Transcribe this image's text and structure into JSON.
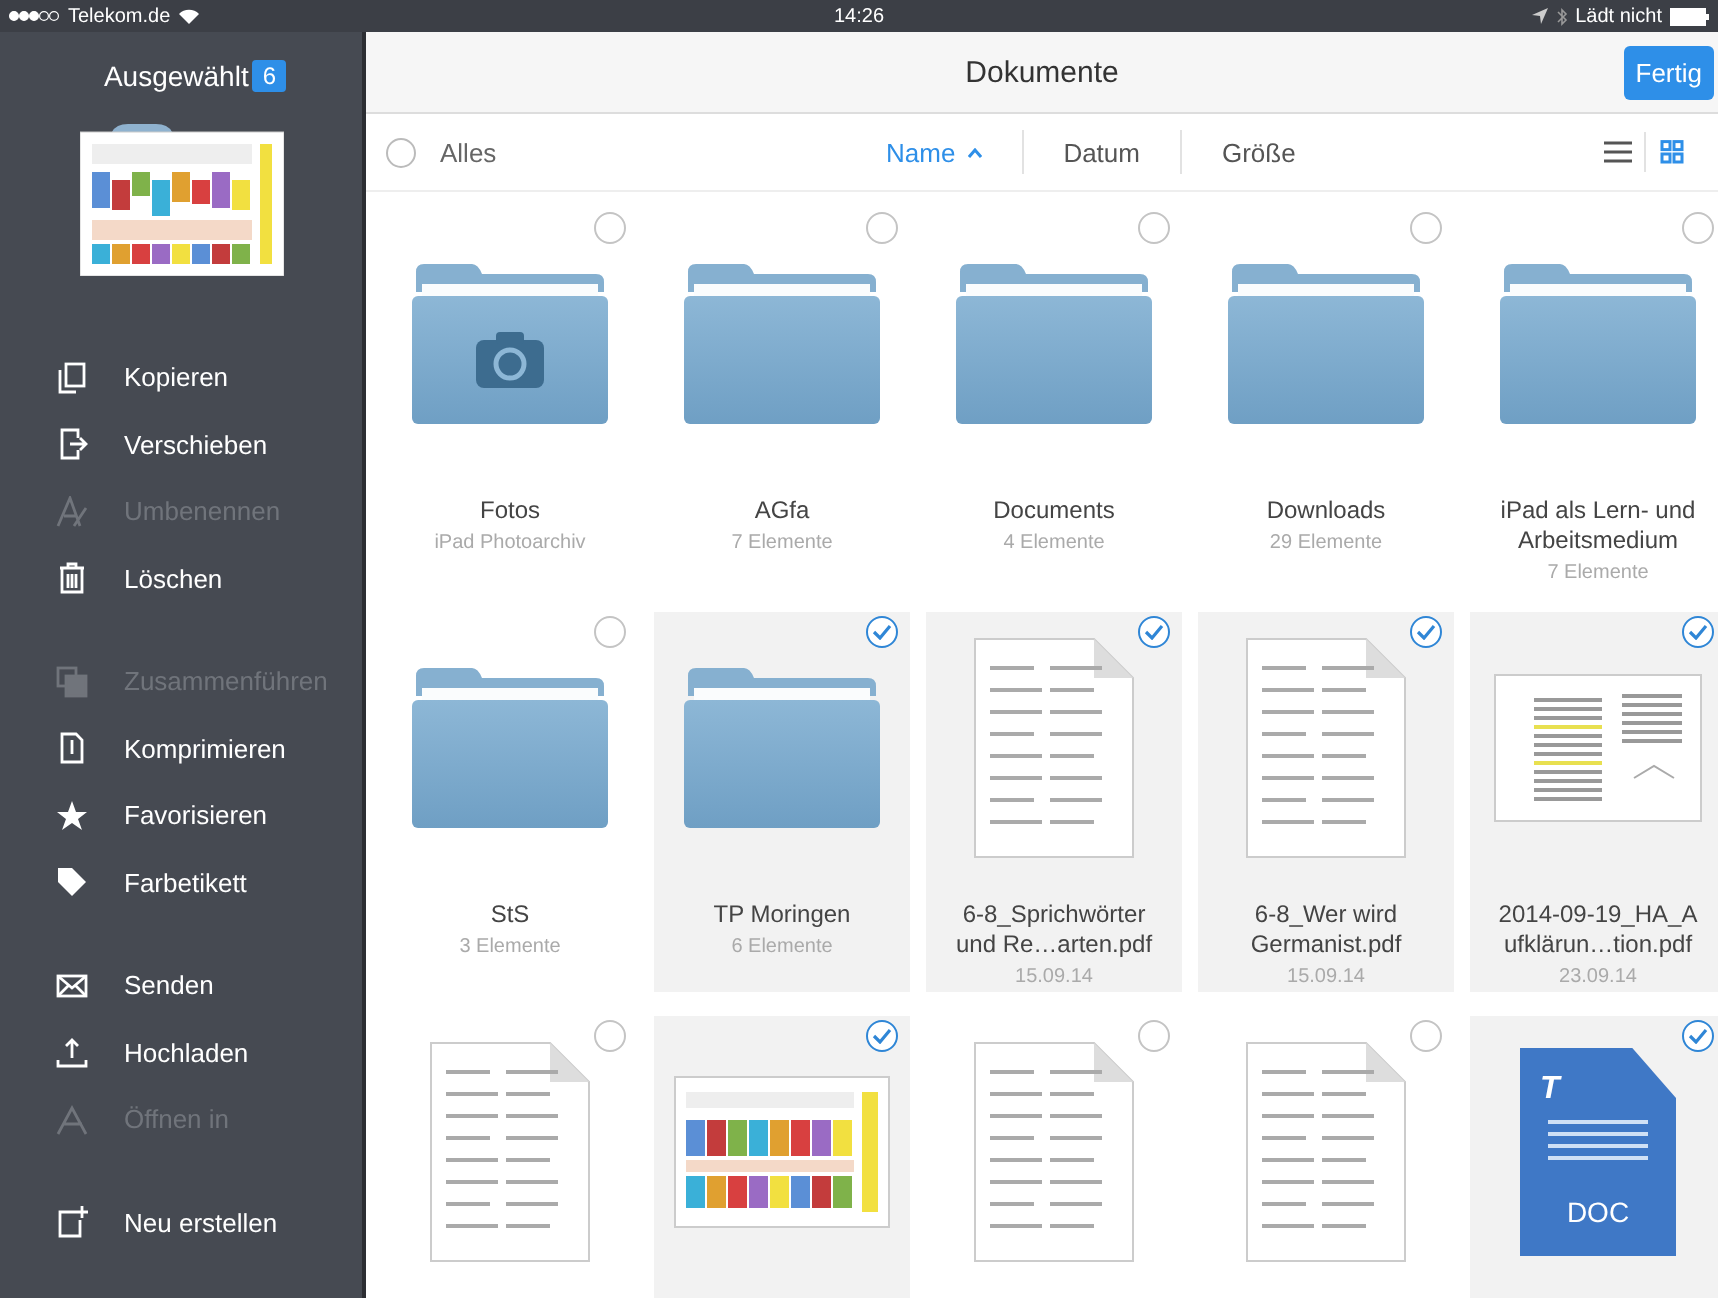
{
  "status_bar": {
    "carrier": "Telekom.de",
    "time": "14:26",
    "charging": "Lädt nicht"
  },
  "sidebar": {
    "title": "Ausgewählt",
    "count": "6",
    "groups": [
      {
        "items": [
          {
            "label": "Kopieren",
            "kind": "copy",
            "disabled": false
          },
          {
            "label": "Verschieben",
            "kind": "move",
            "disabled": false
          },
          {
            "label": "Umbenennen",
            "kind": "rename",
            "disabled": true
          },
          {
            "label": "Löschen",
            "kind": "trash",
            "disabled": false
          }
        ]
      },
      {
        "items": [
          {
            "label": "Zusammenführen",
            "kind": "merge",
            "disabled": true
          },
          {
            "label": "Komprimieren",
            "kind": "zip",
            "disabled": false
          },
          {
            "label": "Favorisieren",
            "kind": "star",
            "disabled": false
          },
          {
            "label": "Farbetikett",
            "kind": "tag",
            "disabled": false
          }
        ]
      },
      {
        "items": [
          {
            "label": "Senden",
            "kind": "mail",
            "disabled": false
          },
          {
            "label": "Hochladen",
            "kind": "upload",
            "disabled": false
          },
          {
            "label": "Öffnen in",
            "kind": "openin",
            "disabled": true
          }
        ]
      },
      {
        "items": [
          {
            "label": "Neu erstellen",
            "kind": "new",
            "disabled": false
          }
        ]
      }
    ]
  },
  "header": {
    "title": "Dokumente",
    "done_button": "Fertig"
  },
  "toolbar": {
    "select_all": {
      "label": "Alles",
      "checked": false
    },
    "sort_options": [
      {
        "label": "Name",
        "selected": true
      },
      {
        "label": "Datum",
        "selected": false
      },
      {
        "label": "Größe",
        "selected": false
      }
    ],
    "view_modes": [
      {
        "kind": "list",
        "selected": false
      },
      {
        "kind": "grid",
        "selected": true
      }
    ]
  },
  "items": [
    {
      "kind": "camera-folder",
      "name": "Fotos",
      "detail": "iPad Photoarchiv",
      "selected": false
    },
    {
      "kind": "folder",
      "name": "AGfa",
      "detail": "7 Elemente",
      "selected": false
    },
    {
      "kind": "folder",
      "name": "Documents",
      "detail": "4 Elemente",
      "selected": false
    },
    {
      "kind": "folder",
      "name": "Downloads",
      "detail": "29 Elemente",
      "selected": false
    },
    {
      "kind": "folder",
      "name": "iPad als Lern- und Arbeitsmedium",
      "detail": "7 Elemente",
      "selected": false
    },
    {
      "kind": "folder",
      "name": "StS",
      "detail": "3 Elemente",
      "selected": false
    },
    {
      "kind": "folder",
      "name": "TP Moringen",
      "detail": "6 Elemente",
      "selected": true
    },
    {
      "kind": "page",
      "name": "6-8_Sprichwörter und Re…arten.pdf",
      "detail": "15.09.14",
      "selected": true
    },
    {
      "kind": "page",
      "name": "6-8_Wer wird Germanist.pdf",
      "detail": "15.09.14",
      "selected": true
    },
    {
      "kind": "sheet",
      "name": "2014-09-19_HA_A ufklärun…tion.pdf",
      "detail": "23.09.14",
      "selected": true
    },
    {
      "kind": "page",
      "selected": false
    },
    {
      "kind": "timetable",
      "selected": true
    },
    {
      "kind": "page",
      "selected": false
    },
    {
      "kind": "page",
      "selected": false
    },
    {
      "kind": "doc",
      "letter": "T",
      "badge": "DOC",
      "selected": true
    }
  ]
}
